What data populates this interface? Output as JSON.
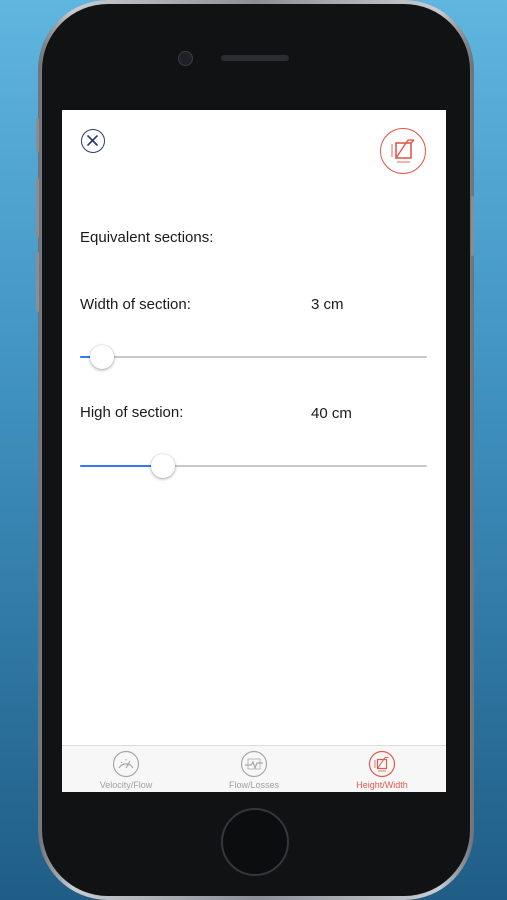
{
  "header": {
    "close_icon": "close-circle-icon",
    "mode_icon": "section-dimensions-icon",
    "accent_color": "#e35a4d"
  },
  "main": {
    "section_title": "Equivalent sections:",
    "width": {
      "label": "Width of section:",
      "value_text": "3 cm",
      "slider_fraction": 0.03
    },
    "height": {
      "label": "High of section:",
      "value_text": "40 cm",
      "slider_fraction": 0.22
    }
  },
  "tabbar": {
    "tabs": [
      {
        "label": "Velocity/Flow",
        "icon": "gauge-icon",
        "active": false
      },
      {
        "label": "Flow/Losses",
        "icon": "flow-losses-icon",
        "active": false
      },
      {
        "label": "Height/Width",
        "icon": "section-dimensions-icon",
        "active": true
      }
    ]
  }
}
